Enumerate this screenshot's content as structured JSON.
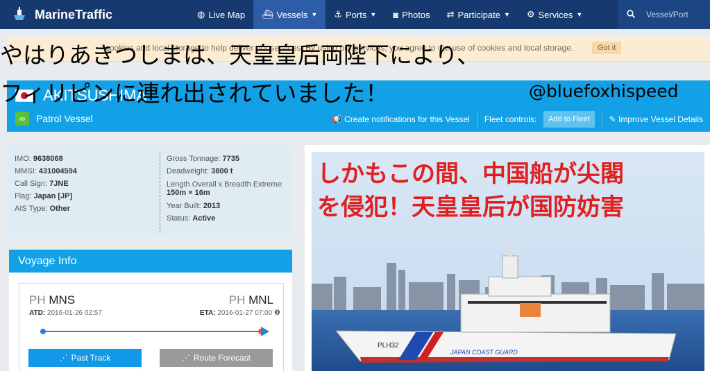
{
  "nav": {
    "logo": "MarineTraffic",
    "items": [
      {
        "label": "Live Map",
        "icon": "globe-icon",
        "active": false,
        "caret": false
      },
      {
        "label": "Vessels",
        "icon": "ship-icon",
        "active": true,
        "caret": true
      },
      {
        "label": "Ports",
        "icon": "anchor-icon",
        "active": false,
        "caret": true
      },
      {
        "label": "Photos",
        "icon": "camera-icon",
        "active": false,
        "caret": false
      },
      {
        "label": "Participate",
        "icon": "share-icon",
        "active": false,
        "caret": true
      },
      {
        "label": "Services",
        "icon": "gear-icon",
        "active": false,
        "caret": true
      }
    ],
    "search_placeholder": "Vessel/Port"
  },
  "cookie": {
    "text_visible": "cookies and local storage to help deliver our services. By using our services, you agree to our use of cookies and local storage.",
    "got_it": "Got it"
  },
  "overlay": {
    "line1": "やはりあきつしまは、天皇皇后両陛下により、",
    "line2": "フィリピンに連れ出されていました！",
    "handle": "@bluefoxhispeed"
  },
  "vessel": {
    "name": "AKITSUSHIMA",
    "type": "Patrol Vessel",
    "create_notifications": "Create notifications for this Vessel",
    "fleet_controls": "Fleet controls:",
    "add_to_fleet": "Add to Fleet",
    "improve_details": "Improve Vessel Details"
  },
  "info": {
    "imo_label": "IMO:",
    "imo": "9638068",
    "mmsi_label": "MMSI:",
    "mmsi": "431004594",
    "callsign_label": "Call Sign:",
    "callsign": "7JNE",
    "flag_label": "Flag:",
    "flag": "Japan [JP]",
    "ais_label": "AIS Type:",
    "ais": "Other",
    "gt_label": "Gross Tonnage:",
    "gt": "7735",
    "dwt_label": "Deadweight:",
    "dwt": "3800 t",
    "loa_label": "Length Overall x Breadth Extreme:",
    "loa": "150m × 16m",
    "year_label": "Year Built:",
    "year": "2013",
    "status_label": "Status:",
    "status": "Active"
  },
  "voyage": {
    "title": "Voyage Info",
    "from_cc": "PH",
    "from": "MNS",
    "to_cc": "PH",
    "to": "MNL",
    "atd_label": "ATD:",
    "atd": "2016-01-26 02:57",
    "eta_label": "ETA:",
    "eta": "2016-01-27 07:00",
    "past_track": "Past Track",
    "route_forecast": "Route Forecast"
  },
  "photo": {
    "caption_line1": "しかもこの間、中国船が尖閣",
    "caption_line2": "を侵犯！天皇皇后が国防妨害",
    "hull_mark": "PLH32",
    "hull_text": "JAPAN COAST GUARD"
  },
  "colors": {
    "nav": "#163a70",
    "accent": "#12a0e6",
    "caption": "#e02020"
  }
}
